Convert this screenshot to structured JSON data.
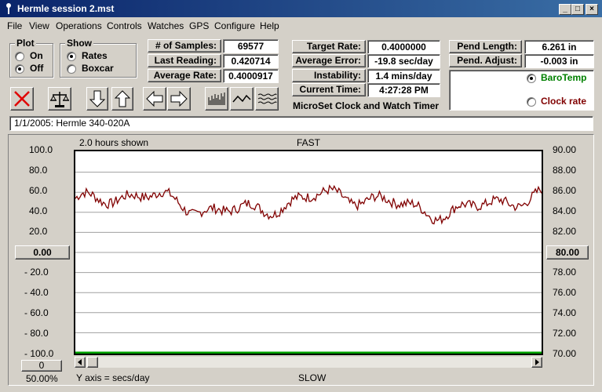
{
  "window": {
    "title": "Hermle session 2.mst",
    "min_label": "_",
    "max_label": "□",
    "close_label": "×"
  },
  "menu": [
    "File",
    "View",
    "Operations",
    "Controls",
    "Watches",
    "GPS",
    "Configure",
    "Help"
  ],
  "plot_group": {
    "title": "Plot",
    "options": [
      "On",
      "Off"
    ],
    "selected": "Off"
  },
  "show_group": {
    "title": "Show",
    "options": [
      "Rates",
      "Boxcar"
    ],
    "selected": "Rates"
  },
  "stats": {
    "samples_label": "# of Samples:",
    "samples_value": "69577",
    "last_label": "Last Reading:",
    "last_value": "0.420714",
    "avg_label": "Average Rate:",
    "avg_value": "0.4000917"
  },
  "rates": {
    "target_label": "Target Rate:",
    "target_value": "0.4000000",
    "error_label": "Average Error:",
    "error_value": "-19.8 sec/day",
    "instab_label": "Instability:",
    "instab_value": "1.4 mins/day",
    "time_label": "Current Time:",
    "time_value": "4:27:28 PM"
  },
  "pendulum": {
    "length_label": "Pend Length:",
    "length_value": "6.261 in",
    "adjust_label": "Pend. Adjust:",
    "adjust_value": "-0.003 in",
    "options": [
      "BaroTemp",
      "Clock rate"
    ],
    "selected": "BaroTemp",
    "baro_color": "#008000",
    "clock_color": "#800000"
  },
  "app_name": "MicroSet Clock and Watch Timer",
  "description": "1/1/2005: Hermle 340-020A",
  "chart": {
    "hours_shown": "2.0 hours shown",
    "top_label": "FAST",
    "bottom_label": "SLOW",
    "y_axis_note": "Y axis = secs/day",
    "left_ticks": [
      "100.0",
      "80.0",
      "60.0",
      "40.0",
      "20.0",
      "- 20.0",
      "- 40.0",
      "- 60.0",
      "- 80.0",
      "- 100.0"
    ],
    "right_ticks": [
      "90.00",
      "88.00",
      "86.00",
      "84.00",
      "82.00",
      "78.00",
      "76.00",
      "74.00",
      "72.00",
      "70.00"
    ],
    "left_center": "0.00",
    "right_center": "80.00",
    "zoom_value": "0",
    "zoom_pct": "50.00%",
    "line_color": "#800000",
    "baseline_color": "#00a000"
  },
  "chart_data": {
    "type": "line",
    "ylim": [
      -100,
      100
    ],
    "y2lim": [
      70,
      90
    ],
    "points": 300
  }
}
